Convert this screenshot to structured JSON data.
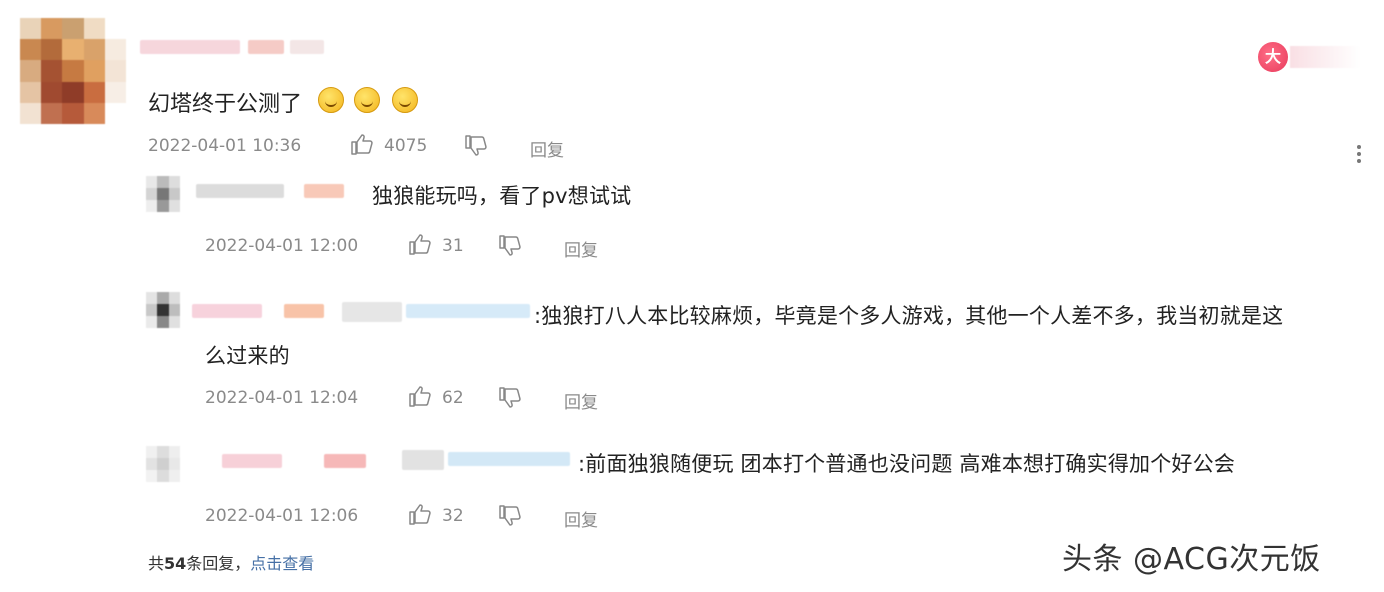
{
  "main_comment": {
    "text": "幻塔终于公测了",
    "timestamp": "2022-04-01 10:36",
    "likes": "4075",
    "reply_label": "回复",
    "badge": "大"
  },
  "replies": [
    {
      "text": "独狼能玩吗，看了pv想试试",
      "timestamp": "2022-04-01 12:00",
      "likes": "31",
      "reply_label": "回复"
    },
    {
      "text": ":独狼打八人本比较麻烦，毕竟是个多人游戏，其他一个人差不多，我当初就是这",
      "text2": "么过来的",
      "timestamp": "2022-04-01 12:04",
      "likes": "62",
      "reply_label": "回复"
    },
    {
      "text": ":前面独狼随便玩 团本打个普通也没问题 高难本想打确实得加个好公会",
      "timestamp": "2022-04-01 12:06",
      "likes": "32",
      "reply_label": "回复"
    }
  ],
  "footer": {
    "total_prefix": "共",
    "total_count": "54",
    "total_suffix": "条回复，",
    "view_link": "点击查看"
  },
  "watermark": "头条 @ACG次元饭"
}
